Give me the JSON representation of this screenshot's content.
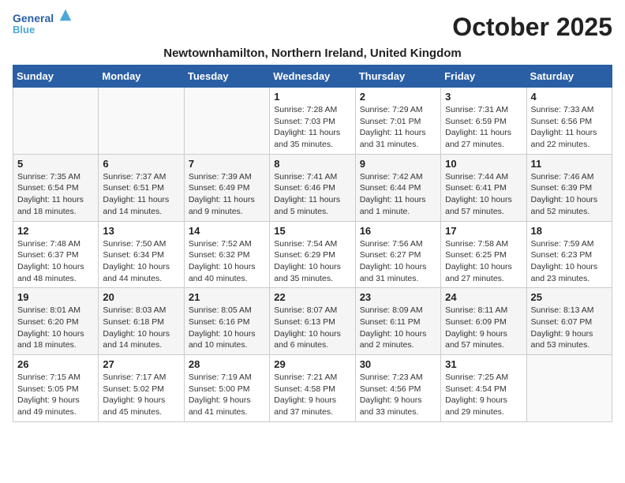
{
  "header": {
    "logo_line1": "General",
    "logo_line2": "Blue",
    "month_title": "October 2025",
    "location": "Newtownhamilton, Northern Ireland, United Kingdom"
  },
  "days_of_week": [
    "Sunday",
    "Monday",
    "Tuesday",
    "Wednesday",
    "Thursday",
    "Friday",
    "Saturday"
  ],
  "weeks": [
    [
      {
        "day": "",
        "info": ""
      },
      {
        "day": "",
        "info": ""
      },
      {
        "day": "",
        "info": ""
      },
      {
        "day": "1",
        "info": "Sunrise: 7:28 AM\nSunset: 7:03 PM\nDaylight: 11 hours\nand 35 minutes."
      },
      {
        "day": "2",
        "info": "Sunrise: 7:29 AM\nSunset: 7:01 PM\nDaylight: 11 hours\nand 31 minutes."
      },
      {
        "day": "3",
        "info": "Sunrise: 7:31 AM\nSunset: 6:59 PM\nDaylight: 11 hours\nand 27 minutes."
      },
      {
        "day": "4",
        "info": "Sunrise: 7:33 AM\nSunset: 6:56 PM\nDaylight: 11 hours\nand 22 minutes."
      }
    ],
    [
      {
        "day": "5",
        "info": "Sunrise: 7:35 AM\nSunset: 6:54 PM\nDaylight: 11 hours\nand 18 minutes."
      },
      {
        "day": "6",
        "info": "Sunrise: 7:37 AM\nSunset: 6:51 PM\nDaylight: 11 hours\nand 14 minutes."
      },
      {
        "day": "7",
        "info": "Sunrise: 7:39 AM\nSunset: 6:49 PM\nDaylight: 11 hours\nand 9 minutes."
      },
      {
        "day": "8",
        "info": "Sunrise: 7:41 AM\nSunset: 6:46 PM\nDaylight: 11 hours\nand 5 minutes."
      },
      {
        "day": "9",
        "info": "Sunrise: 7:42 AM\nSunset: 6:44 PM\nDaylight: 11 hours\nand 1 minute."
      },
      {
        "day": "10",
        "info": "Sunrise: 7:44 AM\nSunset: 6:41 PM\nDaylight: 10 hours\nand 57 minutes."
      },
      {
        "day": "11",
        "info": "Sunrise: 7:46 AM\nSunset: 6:39 PM\nDaylight: 10 hours\nand 52 minutes."
      }
    ],
    [
      {
        "day": "12",
        "info": "Sunrise: 7:48 AM\nSunset: 6:37 PM\nDaylight: 10 hours\nand 48 minutes."
      },
      {
        "day": "13",
        "info": "Sunrise: 7:50 AM\nSunset: 6:34 PM\nDaylight: 10 hours\nand 44 minutes."
      },
      {
        "day": "14",
        "info": "Sunrise: 7:52 AM\nSunset: 6:32 PM\nDaylight: 10 hours\nand 40 minutes."
      },
      {
        "day": "15",
        "info": "Sunrise: 7:54 AM\nSunset: 6:29 PM\nDaylight: 10 hours\nand 35 minutes."
      },
      {
        "day": "16",
        "info": "Sunrise: 7:56 AM\nSunset: 6:27 PM\nDaylight: 10 hours\nand 31 minutes."
      },
      {
        "day": "17",
        "info": "Sunrise: 7:58 AM\nSunset: 6:25 PM\nDaylight: 10 hours\nand 27 minutes."
      },
      {
        "day": "18",
        "info": "Sunrise: 7:59 AM\nSunset: 6:23 PM\nDaylight: 10 hours\nand 23 minutes."
      }
    ],
    [
      {
        "day": "19",
        "info": "Sunrise: 8:01 AM\nSunset: 6:20 PM\nDaylight: 10 hours\nand 18 minutes."
      },
      {
        "day": "20",
        "info": "Sunrise: 8:03 AM\nSunset: 6:18 PM\nDaylight: 10 hours\nand 14 minutes."
      },
      {
        "day": "21",
        "info": "Sunrise: 8:05 AM\nSunset: 6:16 PM\nDaylight: 10 hours\nand 10 minutes."
      },
      {
        "day": "22",
        "info": "Sunrise: 8:07 AM\nSunset: 6:13 PM\nDaylight: 10 hours\nand 6 minutes."
      },
      {
        "day": "23",
        "info": "Sunrise: 8:09 AM\nSunset: 6:11 PM\nDaylight: 10 hours\nand 2 minutes."
      },
      {
        "day": "24",
        "info": "Sunrise: 8:11 AM\nSunset: 6:09 PM\nDaylight: 9 hours\nand 57 minutes."
      },
      {
        "day": "25",
        "info": "Sunrise: 8:13 AM\nSunset: 6:07 PM\nDaylight: 9 hours\nand 53 minutes."
      }
    ],
    [
      {
        "day": "26",
        "info": "Sunrise: 7:15 AM\nSunset: 5:05 PM\nDaylight: 9 hours\nand 49 minutes."
      },
      {
        "day": "27",
        "info": "Sunrise: 7:17 AM\nSunset: 5:02 PM\nDaylight: 9 hours\nand 45 minutes."
      },
      {
        "day": "28",
        "info": "Sunrise: 7:19 AM\nSunset: 5:00 PM\nDaylight: 9 hours\nand 41 minutes."
      },
      {
        "day": "29",
        "info": "Sunrise: 7:21 AM\nSunset: 4:58 PM\nDaylight: 9 hours\nand 37 minutes."
      },
      {
        "day": "30",
        "info": "Sunrise: 7:23 AM\nSunset: 4:56 PM\nDaylight: 9 hours\nand 33 minutes."
      },
      {
        "day": "31",
        "info": "Sunrise: 7:25 AM\nSunset: 4:54 PM\nDaylight: 9 hours\nand 29 minutes."
      },
      {
        "day": "",
        "info": ""
      }
    ]
  ]
}
